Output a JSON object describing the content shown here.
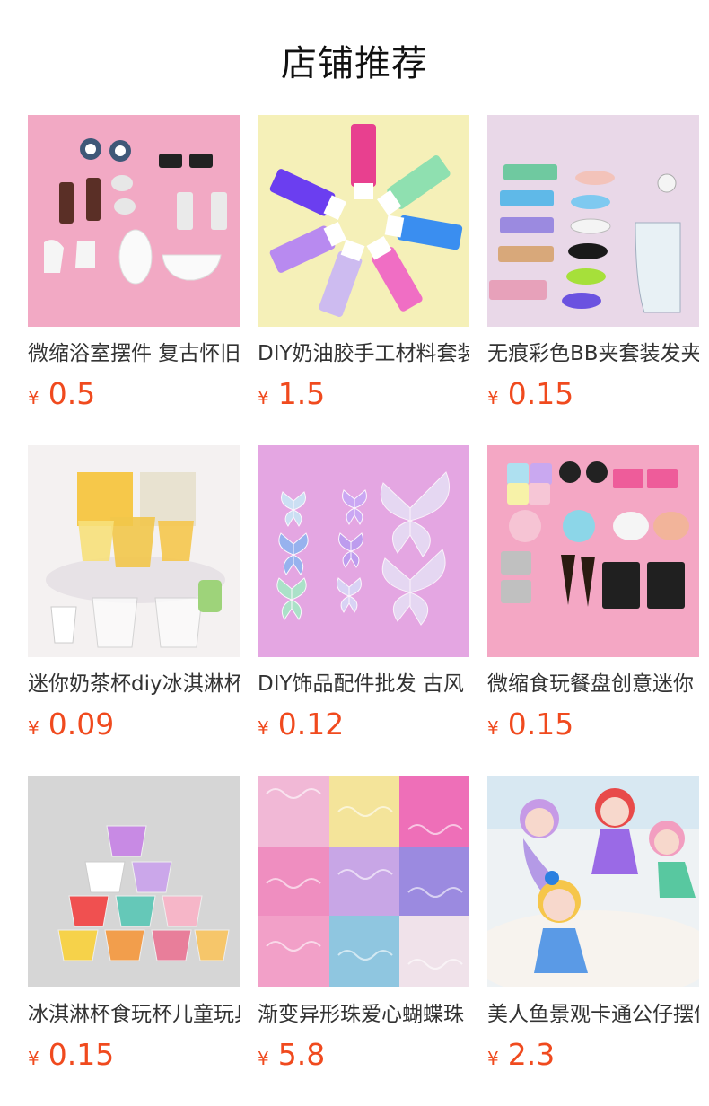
{
  "header": {
    "title": "店铺推荐"
  },
  "products": [
    {
      "title": "微缩浴室摆件 复古怀旧",
      "currency": "¥",
      "price": "0.5",
      "image_icon": "miniature-bathroom-icon"
    },
    {
      "title": "DIY奶油胶手工材料套装",
      "currency": "¥",
      "price": "1.5",
      "image_icon": "cream-glue-tubes-icon"
    },
    {
      "title": "无痕彩色BB夹套装发夹",
      "currency": "¥",
      "price": "0.15",
      "image_icon": "hair-clips-icon"
    },
    {
      "title": "迷你奶茶杯diy冰淇淋杯",
      "currency": "¥",
      "price": "0.09",
      "image_icon": "mini-milk-tea-cup-icon"
    },
    {
      "title": "DIY饰品配件批发 古风",
      "currency": "¥",
      "price": "0.12",
      "image_icon": "butterfly-ornament-icon"
    },
    {
      "title": "微缩食玩餐盘创意迷你",
      "currency": "¥",
      "price": "0.15",
      "image_icon": "mini-tableware-icon"
    },
    {
      "title": "冰淇淋杯食玩杯儿童玩具",
      "currency": "¥",
      "price": "0.15",
      "image_icon": "ice-cream-cups-icon"
    },
    {
      "title": "渐变异形珠爱心蝴蝶珠",
      "currency": "¥",
      "price": "5.8",
      "image_icon": "gradient-beads-icon"
    },
    {
      "title": "美人鱼景观卡通公仔摆件",
      "currency": "¥",
      "price": "2.3",
      "image_icon": "mermaid-figurine-icon"
    }
  ]
}
